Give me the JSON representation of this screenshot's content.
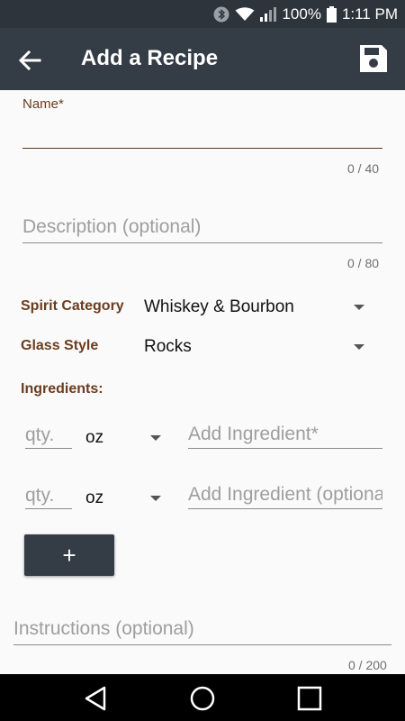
{
  "status_bar": {
    "icons": [
      "bluetooth-icon",
      "wifi-icon",
      "signal-icon",
      "battery-icon"
    ],
    "battery": "100%",
    "time": "1:11 PM"
  },
  "app_bar": {
    "title": "Add a Recipe",
    "back_icon": "arrow-left-icon",
    "save_icon": "floppy-disk-icon"
  },
  "form": {
    "name": {
      "label": "Name*",
      "value": "",
      "counter": "0 / 40"
    },
    "description": {
      "placeholder": "Description (optional)",
      "counter": "0 / 80"
    },
    "spirit_category": {
      "label": "Spirit Category",
      "value": "Whiskey & Bourbon"
    },
    "glass_style": {
      "label": "Glass Style",
      "value": "Rocks"
    },
    "ingredients_label": "Ingredients:",
    "ingredients": [
      {
        "qty_placeholder": "qty.",
        "unit": "oz",
        "name_placeholder": "Add Ingredient*"
      },
      {
        "qty_placeholder": "qty.",
        "unit": "oz",
        "name_placeholder": "Add Ingredient (optional)"
      }
    ],
    "add_button": "+",
    "instructions": {
      "placeholder": "Instructions (optional)",
      "counter": "0 / 200"
    }
  },
  "nav_bar": {
    "icons": [
      "back-triangle-icon",
      "home-circle-icon",
      "recents-square-icon"
    ]
  },
  "colors": {
    "app_bar": "#343c45",
    "status_bar": "#2d343c",
    "label_brown": "#6b3d1e",
    "background": "#fafafa"
  }
}
